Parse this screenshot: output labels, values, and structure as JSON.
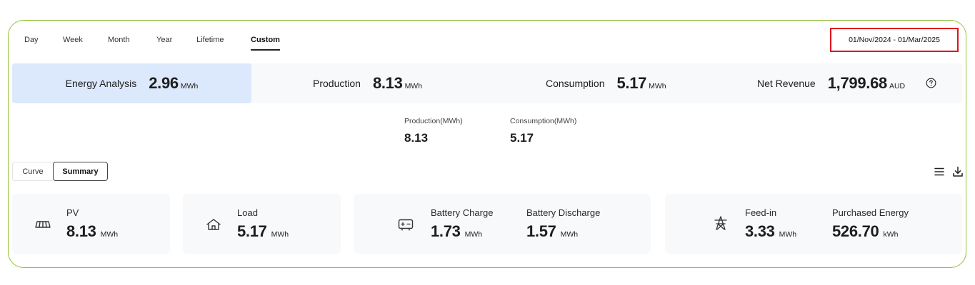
{
  "tabs": [
    {
      "label": "Day"
    },
    {
      "label": "Week"
    },
    {
      "label": "Month"
    },
    {
      "label": "Year"
    },
    {
      "label": "Lifetime"
    },
    {
      "label": "Custom",
      "active": true
    }
  ],
  "date_range": "01/Nov/2024 - 01/Mar/2025",
  "summary": {
    "energy_analysis": {
      "label": "Energy Analysis",
      "value": "2.96",
      "unit": "MWh"
    },
    "production": {
      "label": "Production",
      "value": "8.13",
      "unit": "MWh"
    },
    "consumption": {
      "label": "Consumption",
      "value": "5.17",
      "unit": "MWh"
    },
    "net_revenue": {
      "label": "Net Revenue",
      "value": "1,799.68",
      "unit": "AUD",
      "icon": "help-circle-icon"
    }
  },
  "totals": {
    "production": {
      "label": "Production(MWh)",
      "value": "8.13"
    },
    "consumption": {
      "label": "Consumption(MWh)",
      "value": "5.17"
    }
  },
  "view_toggle": {
    "curve": "Curve",
    "summary": "Summary",
    "selected": "Summary"
  },
  "toolbar_icons": [
    "list-icon",
    "download-icon"
  ],
  "cards": {
    "pv": {
      "icon": "solar-panel-icon",
      "label": "PV",
      "value": "8.13",
      "unit": "MWh"
    },
    "load": {
      "icon": "home-icon",
      "label": "Load",
      "value": "5.17",
      "unit": "MWh"
    },
    "battery_charge": {
      "icon": "battery-icon",
      "label": "Battery Charge",
      "value": "1.73",
      "unit": "MWh"
    },
    "battery_discharge": {
      "label": "Battery Discharge",
      "value": "1.57",
      "unit": "MWh"
    },
    "feed_in": {
      "icon": "grid-tower-icon",
      "label": "Feed-in",
      "value": "3.33",
      "unit": "MWh"
    },
    "purchased": {
      "label": "Purchased Energy",
      "value": "526.70",
      "unit": "kWh"
    }
  },
  "colors": {
    "frame_border": "#94c23c",
    "highlight": "#dce8fb",
    "date_border": "#e0131b"
  }
}
